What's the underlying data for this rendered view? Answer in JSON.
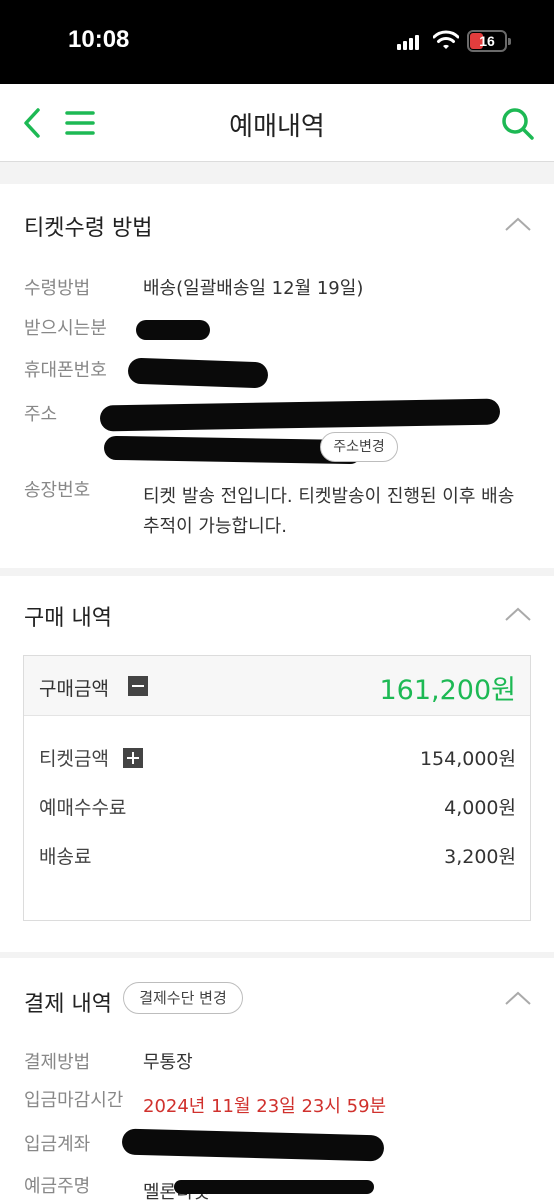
{
  "status_bar": {
    "time": "10:08",
    "battery": "16"
  },
  "header": {
    "title": "예매내역"
  },
  "ticket_receipt": {
    "title": "티켓수령 방법",
    "rows": [
      {
        "label": "수령방법",
        "value": "배송(일괄배송일 12월 19일)"
      },
      {
        "label": "받으시는분"
      },
      {
        "label": "휴대폰번호"
      },
      {
        "label": "주소"
      },
      {
        "label": "송장번호",
        "value_line1": "티켓 발송 전입니다. 티켓발송이 진행된 이후 배송",
        "value_line2": "추적이 가능합니다."
      }
    ],
    "address_change_button": "주소변경"
  },
  "purchase": {
    "title": "구매 내역",
    "total_label": "구매금액",
    "total_value": "161,200원",
    "items": [
      {
        "label": "티켓금액",
        "value": "154,000원"
      },
      {
        "label": "예매수수료",
        "value": "4,000원"
      },
      {
        "label": "배송료",
        "value": "3,200원"
      }
    ]
  },
  "payment": {
    "title": "결제 내역",
    "change_button": "결제수단 변경",
    "rows": [
      {
        "label": "결제방법",
        "value": "무통장"
      },
      {
        "label": "입금마감시간",
        "value": "2024년 11월 23일 23시 59분"
      },
      {
        "label": "입금계좌"
      },
      {
        "label": "예금주명",
        "value": "멜론티켓"
      }
    ]
  },
  "colors": {
    "accent_green": "#1db954",
    "deadline_red": "#d0312d"
  }
}
